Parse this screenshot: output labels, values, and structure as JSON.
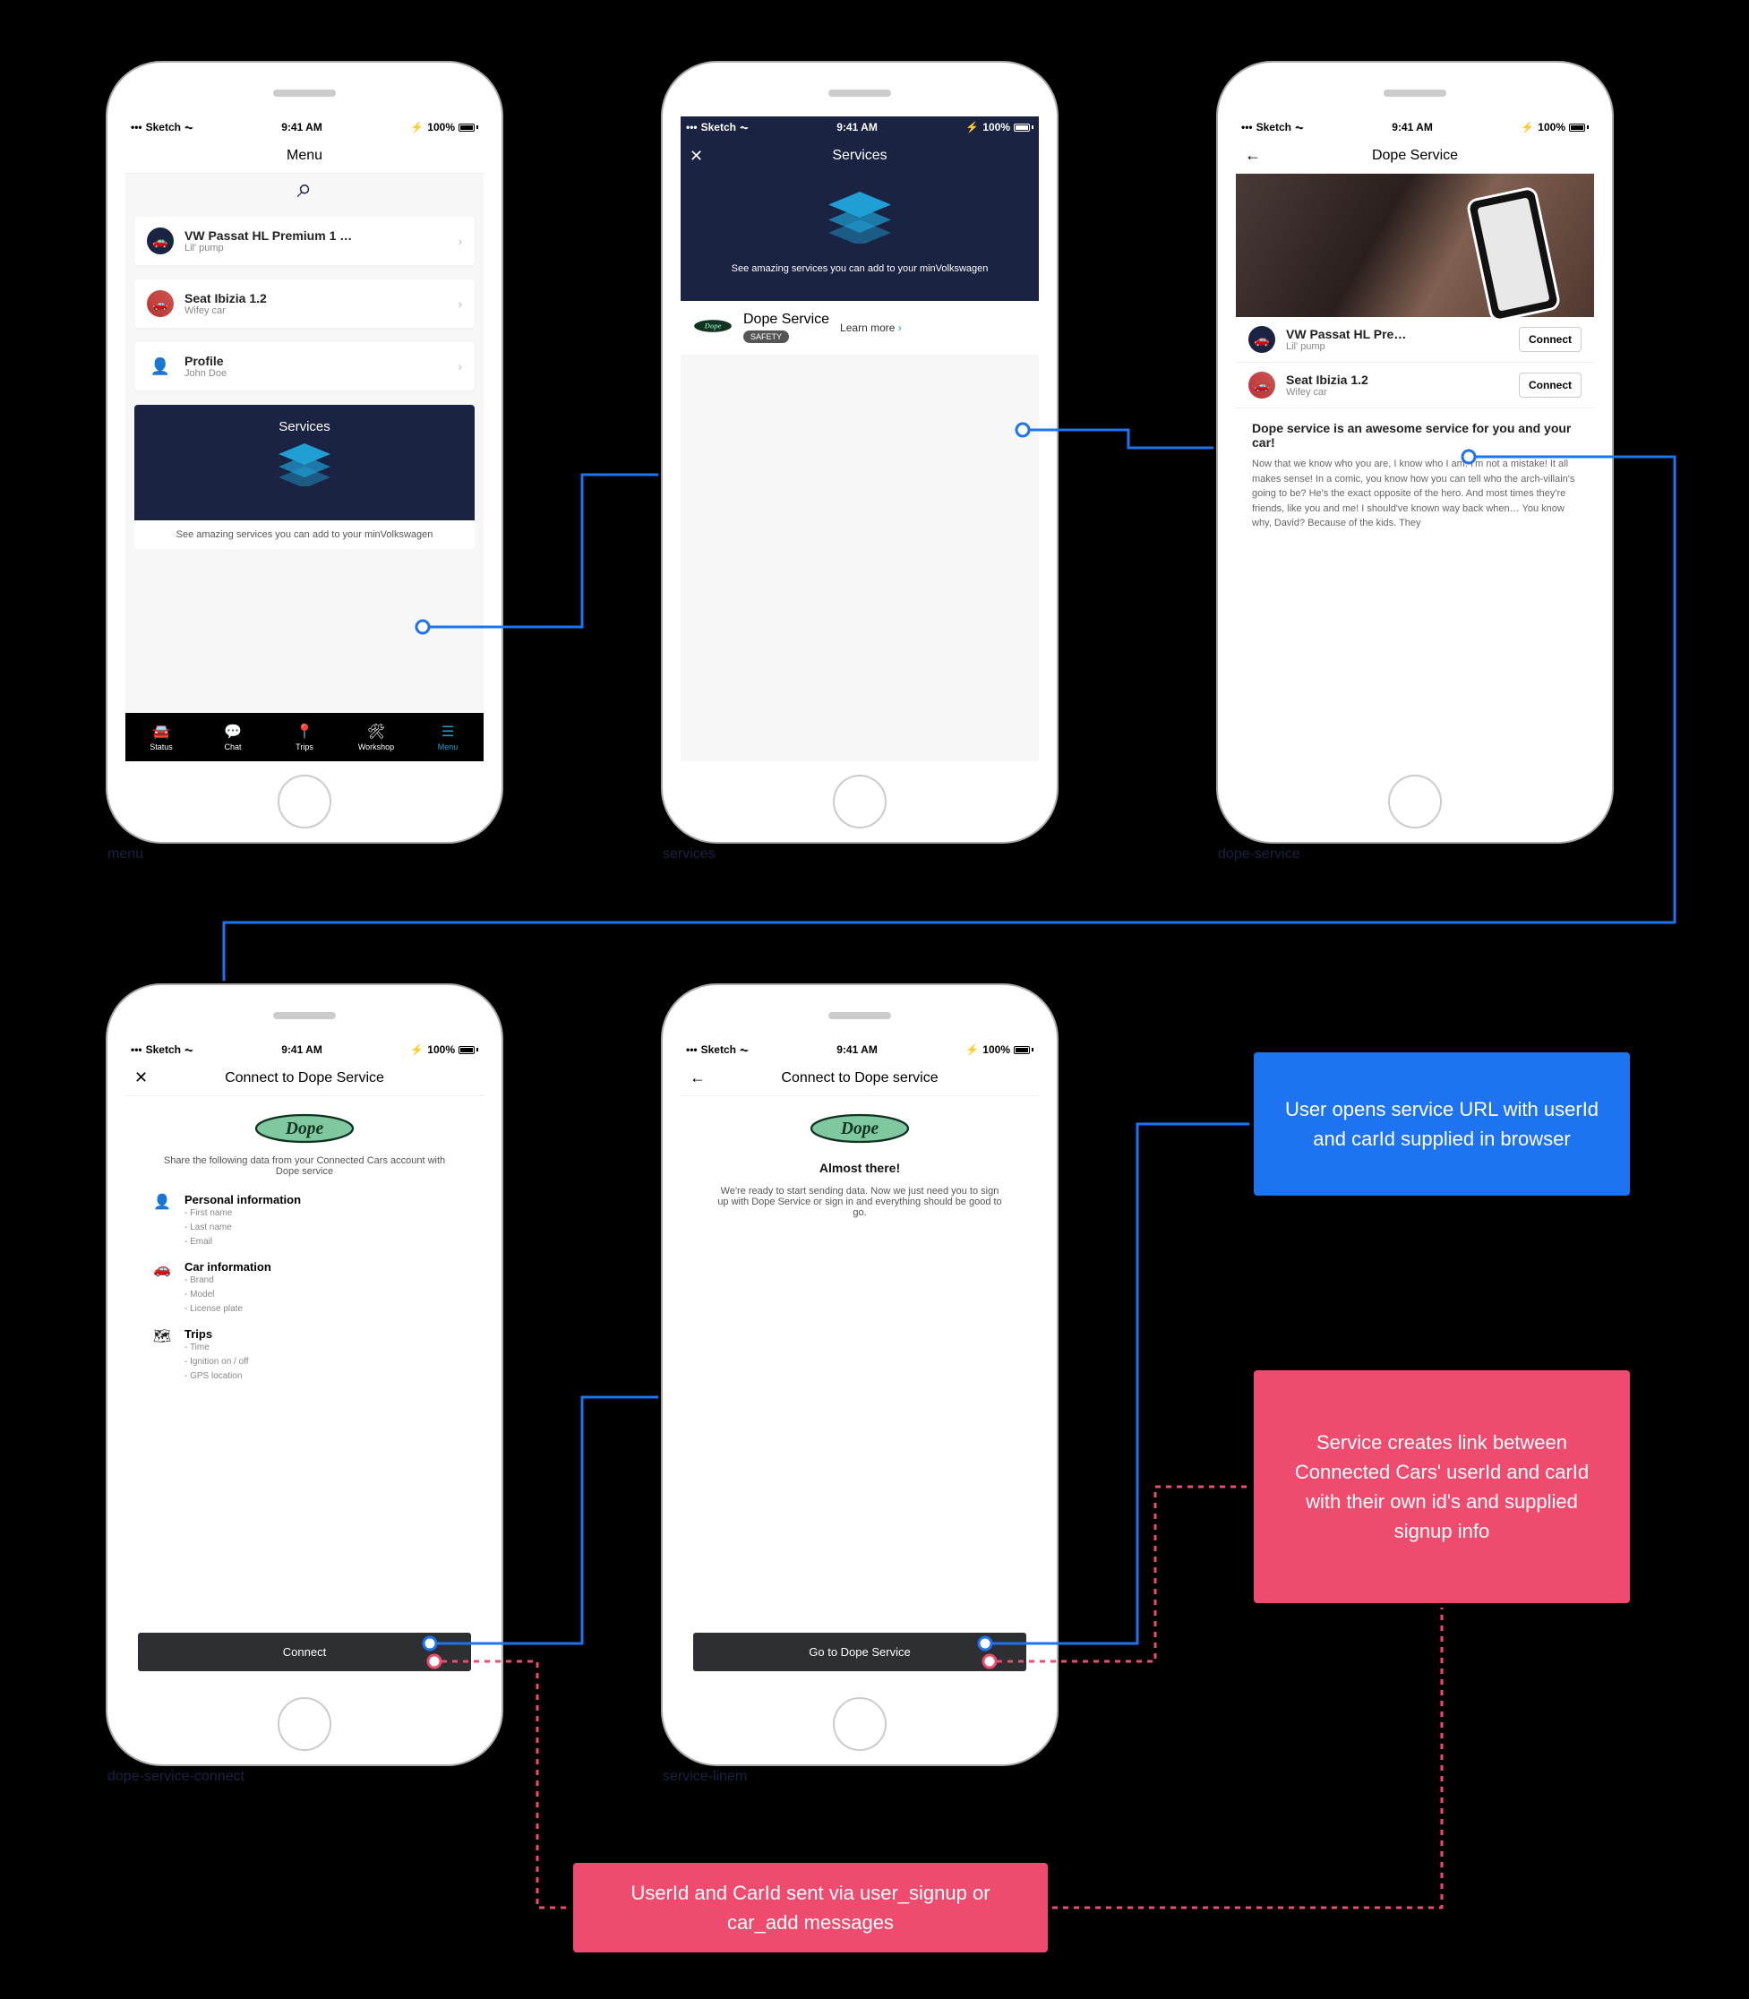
{
  "status": {
    "carrier": "Sketch",
    "time": "9:41 AM",
    "battery": "100%"
  },
  "phones": {
    "menu": {
      "label": "menu",
      "title": "Menu",
      "cars": [
        {
          "name": "VW Passat HL Premium 1 …",
          "sub": "Lil' pump"
        },
        {
          "name": "Seat Ibizia 1.2",
          "sub": "Wifey car"
        }
      ],
      "profile": {
        "name": "Profile",
        "sub": "John Doe"
      },
      "services": {
        "title": "Services",
        "sub": "See amazing services you can add to your minVolkswagen"
      },
      "tabs": [
        "Status",
        "Chat",
        "Trips",
        "Workshop",
        "Menu"
      ]
    },
    "services": {
      "label": "services",
      "title": "Services",
      "hero_sub": "See amazing services you can add to your minVolkswagen",
      "item": {
        "name": "Dope Service",
        "badge": "SAFETY",
        "learn": "Learn more"
      }
    },
    "dope": {
      "label": "dope-service",
      "title": "Dope Service",
      "cars": [
        {
          "name": "VW Passat HL Pre…",
          "sub": "Lil' pump",
          "btn": "Connect"
        },
        {
          "name": "Seat Ibizia 1.2",
          "sub": "Wifey car",
          "btn": "Connect"
        }
      ],
      "desc_h": "Dope service is an awesome service for you and your car!",
      "desc_p": "Now that we know who you are, I know who I am. I'm not a mistake! It all makes sense! In a comic, you know how you can tell who the arch-villain's going to be? He's the exact opposite of the hero. And most times they're friends, like you and me! I should've known way back when… You know why, David? Because of the kids. They"
    },
    "connect": {
      "label": "dope-service-connect",
      "title": "Connect to Dope Service",
      "share": "Share the following data from your Connected Cars account with Dope service",
      "sections": [
        {
          "title": "Personal information",
          "items": [
            "First name",
            "Last name",
            "Email"
          ]
        },
        {
          "title": "Car information",
          "items": [
            "Brand",
            "Model",
            "License plate"
          ]
        },
        {
          "title": "Trips",
          "items": [
            "Time",
            "Ignition on / off",
            "GPS location"
          ]
        }
      ],
      "btn": "Connect"
    },
    "finalize": {
      "label": "service-linem",
      "title": "Connect to Dope service",
      "h": "Almost there!",
      "p": "We're ready to start sending data. Now we just need you to sign up with Dope Service or sign in and everything should be good to go.",
      "btn": "Go to Dope Service"
    }
  },
  "info": {
    "blue": "User opens service URL with userId and carId supplied in browser",
    "pink1": "Service creates link between Connected Cars' userId and carId with their own id's and supplied signup info",
    "pink2": "UserId and CarId sent via user_signup or car_add messages"
  }
}
